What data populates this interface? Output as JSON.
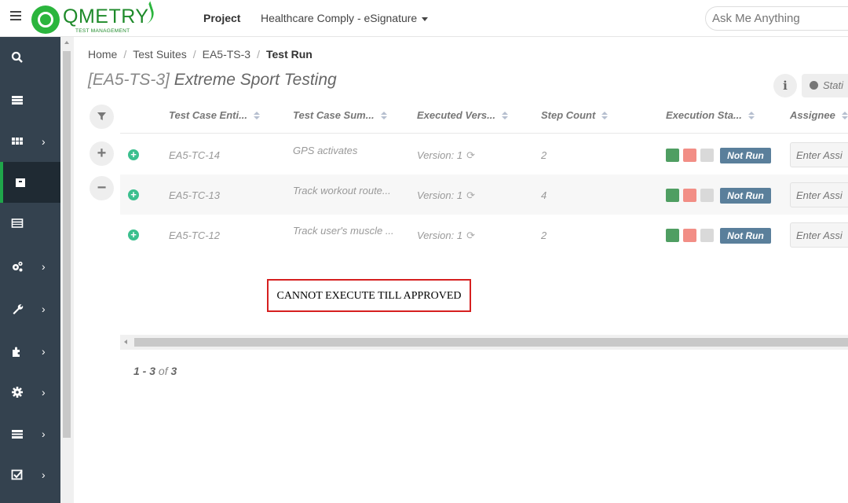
{
  "header": {
    "logo_text": "QMETRY",
    "logo_sub": "TEST MANAGEMENT",
    "project_label": "Project",
    "project_name": "Healthcare Comply - eSignature",
    "search_placeholder": "Ask Me Anything"
  },
  "sidebar": {
    "items": [
      {
        "icon": "search-icon",
        "glyph": "🔍"
      },
      {
        "icon": "list-icon",
        "glyph": "☰"
      },
      {
        "icon": "grid-icon",
        "glyph": "▦",
        "chevron": "›"
      },
      {
        "icon": "archive-icon",
        "glyph": "▣",
        "active": true
      },
      {
        "icon": "table-icon",
        "glyph": "▤"
      },
      {
        "icon": "cogs-icon",
        "glyph": "⚙",
        "chevron": "›"
      },
      {
        "icon": "wrench-icon",
        "glyph": "🔧",
        "chevron": "›"
      },
      {
        "icon": "puzzle-icon",
        "glyph": "✚",
        "chevron": "›"
      },
      {
        "icon": "gear-icon",
        "glyph": "✱",
        "chevron": "›"
      },
      {
        "icon": "report-icon",
        "glyph": "☰",
        "chevron": "›"
      },
      {
        "icon": "checkbox-icon",
        "glyph": "☑",
        "chevron": "›"
      }
    ]
  },
  "breadcrumb": {
    "home": "Home",
    "suites": "Test Suites",
    "suite": "EA5-TS-3",
    "current": "Test Run"
  },
  "page": {
    "title_key": "[EA5-TS-3]",
    "title_name": "Extreme Sport Testing",
    "info_label": "i",
    "stats_label": "Stati"
  },
  "table": {
    "columns": [
      "Test Case Enti...",
      "Test Case Sum...",
      "Executed Vers...",
      "Step Count",
      "Execution Sta...",
      "Assignee"
    ],
    "rows": [
      {
        "entity": "EA5-TC-14",
        "summary": "GPS activates",
        "version": "Version: 1",
        "steps": "2",
        "status": "Not Run",
        "assignee_placeholder": "Enter Assi"
      },
      {
        "entity": "EA5-TC-13",
        "summary": "Track workout route...",
        "version": "Version: 1",
        "steps": "4",
        "status": "Not Run",
        "assignee_placeholder": "Enter Assi"
      },
      {
        "entity": "EA5-TC-12",
        "summary": "Track user's muscle ...",
        "version": "Version: 1",
        "steps": "2",
        "status": "Not Run",
        "assignee_placeholder": "Enter Assi"
      }
    ]
  },
  "warning_text": "CANNOT EXECUTE TILL APPROVED",
  "pager": {
    "range": "1 - 3",
    "of": "of",
    "total": "3"
  },
  "colors": {
    "sidebar": "#34424f",
    "accent": "#1fa64a",
    "status_badge": "#5a7f9b",
    "warning_border": "#d62020"
  }
}
